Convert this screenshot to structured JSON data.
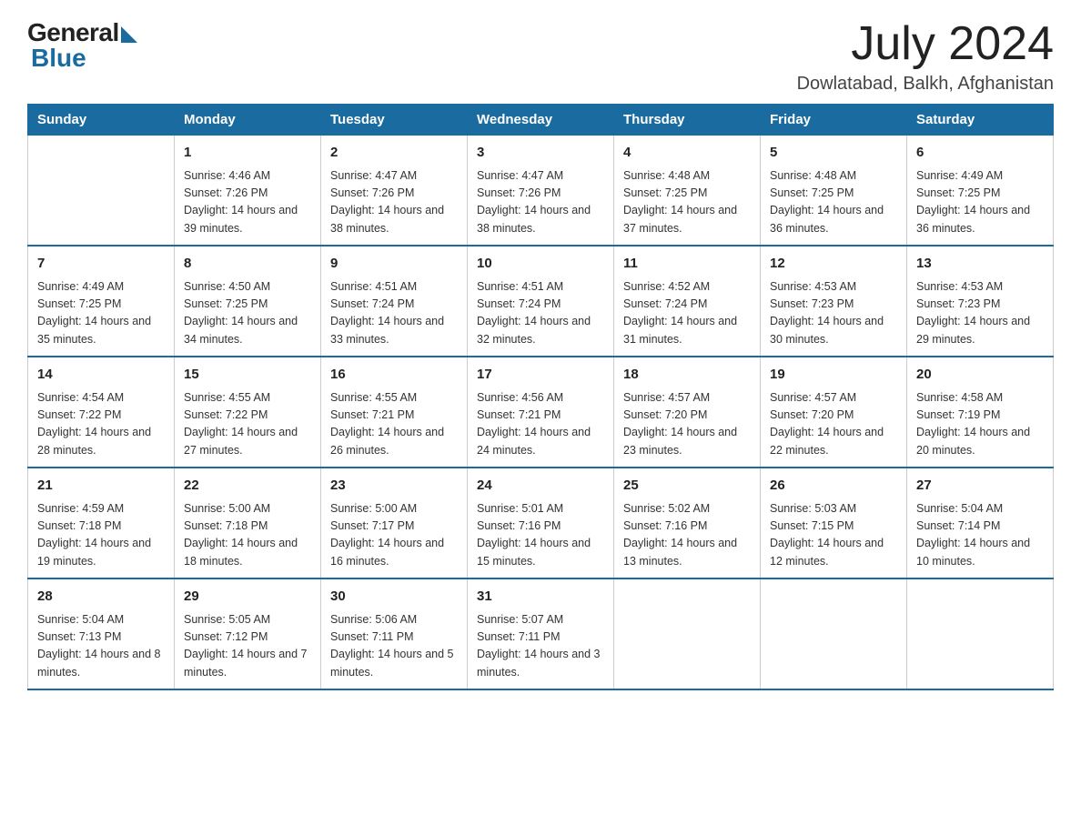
{
  "header": {
    "logo_general": "General",
    "logo_blue": "Blue",
    "month_title": "July 2024",
    "location": "Dowlatabad, Balkh, Afghanistan"
  },
  "columns": [
    "Sunday",
    "Monday",
    "Tuesday",
    "Wednesday",
    "Thursday",
    "Friday",
    "Saturday"
  ],
  "weeks": [
    [
      {
        "num": "",
        "sunrise": "",
        "sunset": "",
        "daylight": ""
      },
      {
        "num": "1",
        "sunrise": "Sunrise: 4:46 AM",
        "sunset": "Sunset: 7:26 PM",
        "daylight": "Daylight: 14 hours and 39 minutes."
      },
      {
        "num": "2",
        "sunrise": "Sunrise: 4:47 AM",
        "sunset": "Sunset: 7:26 PM",
        "daylight": "Daylight: 14 hours and 38 minutes."
      },
      {
        "num": "3",
        "sunrise": "Sunrise: 4:47 AM",
        "sunset": "Sunset: 7:26 PM",
        "daylight": "Daylight: 14 hours and 38 minutes."
      },
      {
        "num": "4",
        "sunrise": "Sunrise: 4:48 AM",
        "sunset": "Sunset: 7:25 PM",
        "daylight": "Daylight: 14 hours and 37 minutes."
      },
      {
        "num": "5",
        "sunrise": "Sunrise: 4:48 AM",
        "sunset": "Sunset: 7:25 PM",
        "daylight": "Daylight: 14 hours and 36 minutes."
      },
      {
        "num": "6",
        "sunrise": "Sunrise: 4:49 AM",
        "sunset": "Sunset: 7:25 PM",
        "daylight": "Daylight: 14 hours and 36 minutes."
      }
    ],
    [
      {
        "num": "7",
        "sunrise": "Sunrise: 4:49 AM",
        "sunset": "Sunset: 7:25 PM",
        "daylight": "Daylight: 14 hours and 35 minutes."
      },
      {
        "num": "8",
        "sunrise": "Sunrise: 4:50 AM",
        "sunset": "Sunset: 7:25 PM",
        "daylight": "Daylight: 14 hours and 34 minutes."
      },
      {
        "num": "9",
        "sunrise": "Sunrise: 4:51 AM",
        "sunset": "Sunset: 7:24 PM",
        "daylight": "Daylight: 14 hours and 33 minutes."
      },
      {
        "num": "10",
        "sunrise": "Sunrise: 4:51 AM",
        "sunset": "Sunset: 7:24 PM",
        "daylight": "Daylight: 14 hours and 32 minutes."
      },
      {
        "num": "11",
        "sunrise": "Sunrise: 4:52 AM",
        "sunset": "Sunset: 7:24 PM",
        "daylight": "Daylight: 14 hours and 31 minutes."
      },
      {
        "num": "12",
        "sunrise": "Sunrise: 4:53 AM",
        "sunset": "Sunset: 7:23 PM",
        "daylight": "Daylight: 14 hours and 30 minutes."
      },
      {
        "num": "13",
        "sunrise": "Sunrise: 4:53 AM",
        "sunset": "Sunset: 7:23 PM",
        "daylight": "Daylight: 14 hours and 29 minutes."
      }
    ],
    [
      {
        "num": "14",
        "sunrise": "Sunrise: 4:54 AM",
        "sunset": "Sunset: 7:22 PM",
        "daylight": "Daylight: 14 hours and 28 minutes."
      },
      {
        "num": "15",
        "sunrise": "Sunrise: 4:55 AM",
        "sunset": "Sunset: 7:22 PM",
        "daylight": "Daylight: 14 hours and 27 minutes."
      },
      {
        "num": "16",
        "sunrise": "Sunrise: 4:55 AM",
        "sunset": "Sunset: 7:21 PM",
        "daylight": "Daylight: 14 hours and 26 minutes."
      },
      {
        "num": "17",
        "sunrise": "Sunrise: 4:56 AM",
        "sunset": "Sunset: 7:21 PM",
        "daylight": "Daylight: 14 hours and 24 minutes."
      },
      {
        "num": "18",
        "sunrise": "Sunrise: 4:57 AM",
        "sunset": "Sunset: 7:20 PM",
        "daylight": "Daylight: 14 hours and 23 minutes."
      },
      {
        "num": "19",
        "sunrise": "Sunrise: 4:57 AM",
        "sunset": "Sunset: 7:20 PM",
        "daylight": "Daylight: 14 hours and 22 minutes."
      },
      {
        "num": "20",
        "sunrise": "Sunrise: 4:58 AM",
        "sunset": "Sunset: 7:19 PM",
        "daylight": "Daylight: 14 hours and 20 minutes."
      }
    ],
    [
      {
        "num": "21",
        "sunrise": "Sunrise: 4:59 AM",
        "sunset": "Sunset: 7:18 PM",
        "daylight": "Daylight: 14 hours and 19 minutes."
      },
      {
        "num": "22",
        "sunrise": "Sunrise: 5:00 AM",
        "sunset": "Sunset: 7:18 PM",
        "daylight": "Daylight: 14 hours and 18 minutes."
      },
      {
        "num": "23",
        "sunrise": "Sunrise: 5:00 AM",
        "sunset": "Sunset: 7:17 PM",
        "daylight": "Daylight: 14 hours and 16 minutes."
      },
      {
        "num": "24",
        "sunrise": "Sunrise: 5:01 AM",
        "sunset": "Sunset: 7:16 PM",
        "daylight": "Daylight: 14 hours and 15 minutes."
      },
      {
        "num": "25",
        "sunrise": "Sunrise: 5:02 AM",
        "sunset": "Sunset: 7:16 PM",
        "daylight": "Daylight: 14 hours and 13 minutes."
      },
      {
        "num": "26",
        "sunrise": "Sunrise: 5:03 AM",
        "sunset": "Sunset: 7:15 PM",
        "daylight": "Daylight: 14 hours and 12 minutes."
      },
      {
        "num": "27",
        "sunrise": "Sunrise: 5:04 AM",
        "sunset": "Sunset: 7:14 PM",
        "daylight": "Daylight: 14 hours and 10 minutes."
      }
    ],
    [
      {
        "num": "28",
        "sunrise": "Sunrise: 5:04 AM",
        "sunset": "Sunset: 7:13 PM",
        "daylight": "Daylight: 14 hours and 8 minutes."
      },
      {
        "num": "29",
        "sunrise": "Sunrise: 5:05 AM",
        "sunset": "Sunset: 7:12 PM",
        "daylight": "Daylight: 14 hours and 7 minutes."
      },
      {
        "num": "30",
        "sunrise": "Sunrise: 5:06 AM",
        "sunset": "Sunset: 7:11 PM",
        "daylight": "Daylight: 14 hours and 5 minutes."
      },
      {
        "num": "31",
        "sunrise": "Sunrise: 5:07 AM",
        "sunset": "Sunset: 7:11 PM",
        "daylight": "Daylight: 14 hours and 3 minutes."
      },
      {
        "num": "",
        "sunrise": "",
        "sunset": "",
        "daylight": ""
      },
      {
        "num": "",
        "sunrise": "",
        "sunset": "",
        "daylight": ""
      },
      {
        "num": "",
        "sunrise": "",
        "sunset": "",
        "daylight": ""
      }
    ]
  ]
}
